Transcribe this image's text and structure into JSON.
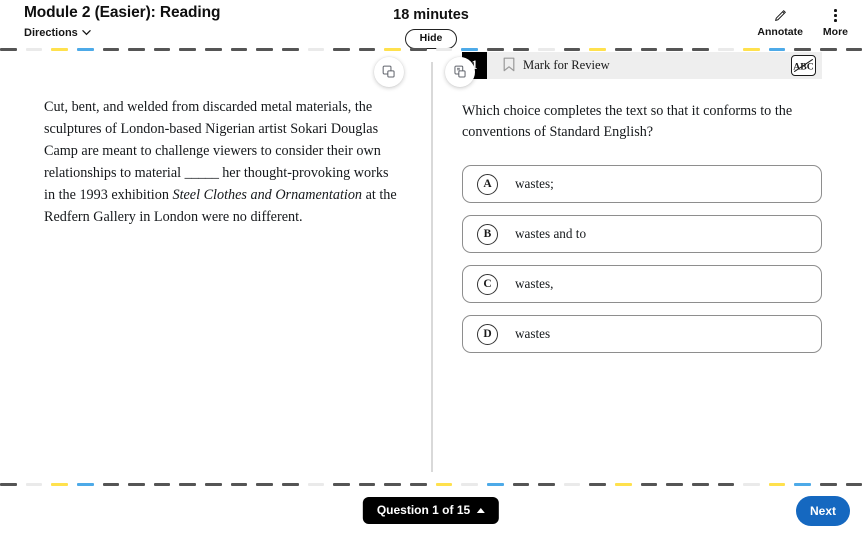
{
  "header": {
    "module_title": "Module 2 (Easier): Reading",
    "directions_label": "Directions",
    "timer_text": "18 minutes",
    "hide_label": "Hide",
    "annotate_label": "Annotate",
    "more_label": "More"
  },
  "panel_controls": {
    "left_expand_name": "expand-left-panel",
    "right_expand_name": "expand-right-panel"
  },
  "passage": {
    "part1": "Cut, bent, and welded from discarded metal materials, the sculptures of London-based Nigerian artist Sokari Douglas Camp are meant to challenge viewers to consider their own relationships to material ",
    "blank": "_____",
    "part2": " her thought-provoking works in the 1993 exhibition ",
    "title_italic": "Steel Clothes and Ornamentation",
    "part3": " at the Redfern Gallery in London were no different."
  },
  "question": {
    "number": "1",
    "mark_for_review_label": "Mark for Review",
    "cross_out_label": "ABC",
    "stem": "Which choice completes the text so that it conforms to the conventions of Standard English?",
    "choices": [
      {
        "letter": "A",
        "text": "wastes;"
      },
      {
        "letter": "B",
        "text": "wastes and to"
      },
      {
        "letter": "C",
        "text": "wastes,"
      },
      {
        "letter": "D",
        "text": "wastes"
      }
    ]
  },
  "footer": {
    "question_nav_label": "Question 1 of 15",
    "next_label": "Next"
  },
  "colors": {
    "dash_dark": "#555555",
    "dash_light": "#eaeaea",
    "dash_yellow": "#ffe14d",
    "dash_blue": "#4daae8",
    "next_blue": "#1568c0",
    "qnum_black": "#000000",
    "qbar_gray": "#eeeeee"
  },
  "dash_rule_top": [
    "dark",
    "light",
    "yellow",
    "blue",
    "dark",
    "dark",
    "dark",
    "dark",
    "dark",
    "dark",
    "dark",
    "dark",
    "light",
    "dark",
    "dark",
    "yellow",
    "dark",
    "light",
    "blue",
    "dark",
    "dark",
    "light",
    "dark",
    "yellow",
    "dark",
    "dark",
    "dark",
    "dark",
    "light",
    "yellow",
    "blue",
    "dark",
    "dark",
    "dark"
  ],
  "dash_rule_bottom": [
    "dark",
    "light",
    "yellow",
    "blue",
    "dark",
    "dark",
    "dark",
    "dark",
    "dark",
    "dark",
    "dark",
    "dark",
    "light",
    "dark",
    "dark",
    "dark",
    "dark",
    "yellow",
    "light",
    "blue",
    "dark",
    "dark",
    "light",
    "dark",
    "yellow",
    "dark",
    "dark",
    "dark",
    "dark",
    "light",
    "yellow",
    "blue",
    "dark",
    "dark"
  ]
}
